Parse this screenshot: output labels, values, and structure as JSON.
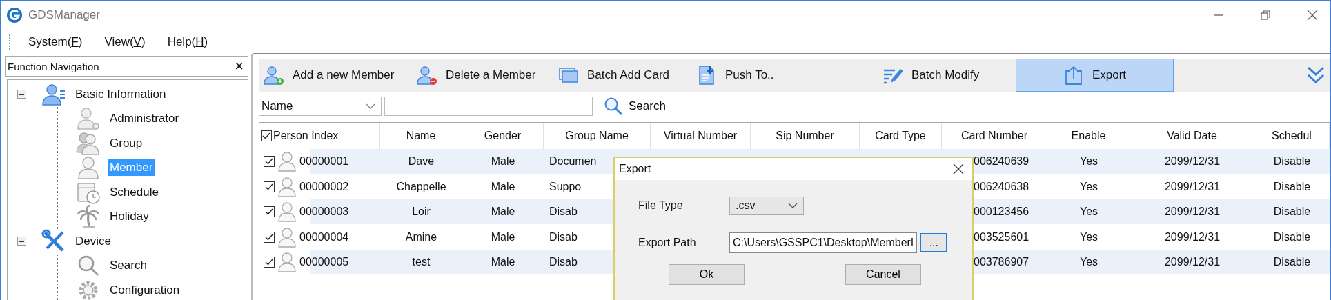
{
  "window": {
    "title": "GDSManager"
  },
  "menu": [
    {
      "label": "System(F)"
    },
    {
      "label": "View(V)"
    },
    {
      "label": "Help(H)"
    }
  ],
  "navigation": {
    "title": "Function Navigation",
    "close": "×",
    "tree": [
      {
        "label": "Basic Information",
        "expanded": true,
        "selected": false,
        "children": [
          {
            "label": "Administrator",
            "selected": false
          },
          {
            "label": "Group",
            "selected": false
          },
          {
            "label": "Member",
            "selected": true
          },
          {
            "label": "Schedule",
            "selected": false
          },
          {
            "label": "Holiday",
            "selected": false
          }
        ]
      },
      {
        "label": "Device",
        "expanded": true,
        "selected": false,
        "children": [
          {
            "label": "Search",
            "selected": false
          },
          {
            "label": "Configuration",
            "selected": false
          }
        ]
      }
    ]
  },
  "toolbar": [
    {
      "label": "Add a new Member",
      "selected": false
    },
    {
      "label": "Delete a Member",
      "selected": false
    },
    {
      "label": "Batch Add Card",
      "selected": false
    },
    {
      "label": "Push To..",
      "selected": false
    },
    {
      "label": "Batch Modify",
      "selected": false
    },
    {
      "label": "Export",
      "selected": true
    }
  ],
  "search": {
    "field": "Name",
    "button": "Search"
  },
  "table": {
    "all_checked": true,
    "columns": [
      "Person Index",
      "Name",
      "Gender",
      "Group Name",
      "Virtual Number",
      "Sip Number",
      "Card Type",
      "Card Number",
      "Enable",
      "Valid Date",
      "Schedul"
    ],
    "rows": [
      {
        "checked": true,
        "person_index": "00000001",
        "name": "Dave",
        "gender": "Male",
        "group_name": "Documen",
        "card_number": "006240639",
        "enable": "Yes",
        "valid_date": "2099/12/31",
        "schedule": "Disable"
      },
      {
        "checked": true,
        "person_index": "00000002",
        "name": "Chappelle",
        "gender": "Male",
        "group_name": "Suppo",
        "card_number": "006240638",
        "enable": "Yes",
        "valid_date": "2099/12/31",
        "schedule": "Disable"
      },
      {
        "checked": true,
        "person_index": "00000003",
        "name": "Loir",
        "gender": "Male",
        "group_name": "Disab",
        "card_number": "000123456",
        "enable": "Yes",
        "valid_date": "2099/12/31",
        "schedule": "Disable"
      },
      {
        "checked": true,
        "person_index": "00000004",
        "name": "Amine",
        "gender": "Male",
        "group_name": "Disab",
        "card_number": "003525601",
        "enable": "Yes",
        "valid_date": "2099/12/31",
        "schedule": "Disable"
      },
      {
        "checked": true,
        "person_index": "00000005",
        "name": "test",
        "gender": "Male",
        "group_name": "Disab",
        "card_number": "003786907",
        "enable": "Yes",
        "valid_date": "2099/12/31",
        "schedule": "Disable"
      }
    ]
  },
  "dialog": {
    "title": "Export",
    "file_type_label": "File Type",
    "file_type": ".csv",
    "export_path_label": "Export Path",
    "export_path": "C:\\Users\\GSSPC1\\Desktop\\MemberI",
    "browse": "...",
    "buttons": [
      "Ok",
      "Cancel"
    ]
  }
}
